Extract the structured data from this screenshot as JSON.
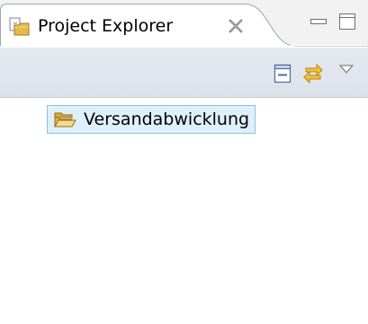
{
  "view": {
    "tab_title": "Project Explorer",
    "tab_icon": "project-explorer-icon",
    "close_icon": "close-icon",
    "minimize_icon": "minimize-icon",
    "maximize_icon": "maximize-icon"
  },
  "toolbar": {
    "collapse_icon": "collapse-all-icon",
    "link_icon": "link-with-editor-icon",
    "menu_icon": "view-menu-chevron-down-icon"
  },
  "tree": {
    "items": [
      {
        "label": "Versandabwicklung",
        "icon": "open-folder-icon",
        "selected": true
      }
    ]
  },
  "colors": {
    "selection_fill": "#dff0fb",
    "selection_border": "#86c2ea",
    "toolbar_bg": "#e3e6ee",
    "folder": "#e6c35a"
  }
}
